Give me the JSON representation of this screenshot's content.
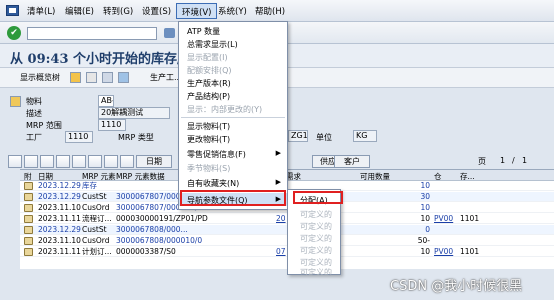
{
  "menubar": {
    "items": [
      "清单(L)",
      "编辑(E)",
      "转到(G)",
      "设置(S)",
      "环境(V)",
      "系统(Y)",
      "帮助(H)"
    ],
    "active_index": 4
  },
  "title": "从 09:43 个小时开始的库存/需...",
  "app_toolbar": {
    "display_overview": "显示概览树",
    "prod_tool": "生产工..."
  },
  "header": {
    "material_label": "物料",
    "material_value": "AB-4",
    "desc_label": "描述",
    "desc_value": "20解耦测试",
    "mrp_area_label": "MRP 范围",
    "mrp_area_value": "1110",
    "plant_label": "工厂",
    "plant_value": "1110",
    "mrp_type_label": "MRP 类型",
    "mrp_type_value": "",
    "zg_value": "ZG10",
    "unit_label": "单位",
    "unit_value": "KG"
  },
  "grid_toolbar": {
    "date_tab": "日期",
    "vendor_tab": "供应商",
    "customer_tab": "客户",
    "page_label": "页",
    "page_current": "1",
    "page_sep": "/",
    "page_total": "1"
  },
  "grid": {
    "headers": [
      "附",
      "日期",
      "MRP 元素",
      "MRP 元素数据",
      "需求",
      "可用数量",
      "仓",
      "存..."
    ],
    "rows": [
      {
        "date": "2023.12.29",
        "element": "库存",
        "data": "",
        "req": "",
        "avail": "10",
        "c1": "",
        "c2": ""
      },
      {
        "date": "2023.12.29",
        "element": "CustSt",
        "data": "3000067807/000...",
        "req": "",
        "avail": "30",
        "c1": "",
        "c2": ""
      },
      {
        "date": "2023.11.10",
        "element": "CusOrd",
        "data": "3000067807/000010/0...",
        "req": "",
        "avail": "10",
        "c1": "",
        "c2": ""
      },
      {
        "date": "2023.11.11",
        "element": "流程订...",
        "data": "000030000191/ZP01/PD",
        "req": "20",
        "avail": "10",
        "c1": "PV00",
        "c2": "1101"
      },
      {
        "date": "2023.12.29",
        "element": "CustSt",
        "data": "3000067808/000...",
        "req": "",
        "avail": "0",
        "c1": "",
        "c2": ""
      },
      {
        "date": "2023.11.10",
        "element": "CusOrd",
        "data": "3000067808/000010/0",
        "req": "",
        "avail": "50-",
        "c1": "",
        "c2": ""
      },
      {
        "date": "2023.11.11",
        "element": "计划订...",
        "data": "0000003387/S0",
        "req": "07",
        "avail": "10",
        "c1": "PV00",
        "c2": "1101"
      }
    ]
  },
  "env_menu": {
    "items": [
      {
        "label": "ATP 数量",
        "disabled": false
      },
      {
        "label": "总需求显示(L)",
        "disabled": false
      },
      {
        "label": "显示配置(I)",
        "disabled": true
      },
      {
        "label": "配额安排(Q)",
        "disabled": true
      },
      {
        "label": "生产版本(R)",
        "disabled": false
      },
      {
        "label": "产品结构(P)",
        "disabled": false
      },
      {
        "label": "显示：内部更改的(Y)",
        "disabled": true
      },
      {
        "label": "显示物料(T)",
        "disabled": false
      },
      {
        "label": "更改物料(T)",
        "disabled": false
      },
      {
        "label": "零售促销信息(F)",
        "disabled": false
      },
      {
        "label": "季节物料(S)",
        "disabled": true
      },
      {
        "label": "自有收藏夹(N)",
        "disabled": false
      },
      {
        "label": "导航参数文件(Q)",
        "disabled": false
      }
    ]
  },
  "submenu": {
    "items": [
      {
        "label": "分配(A)",
        "disabled": false
      },
      {
        "label": "可定义的",
        "disabled": true
      },
      {
        "label": "可定义的",
        "disabled": true
      },
      {
        "label": "可定义的",
        "disabled": true
      },
      {
        "label": "可定义的",
        "disabled": true
      },
      {
        "label": "可定义的",
        "disabled": true
      },
      {
        "label": "可定义的",
        "disabled": true
      }
    ]
  },
  "watermark": "CSDN @我小时候很黑",
  "colors": {
    "highlight": "#cfe0f5",
    "red_box": "#e02020",
    "link": "#1a3fa8"
  }
}
